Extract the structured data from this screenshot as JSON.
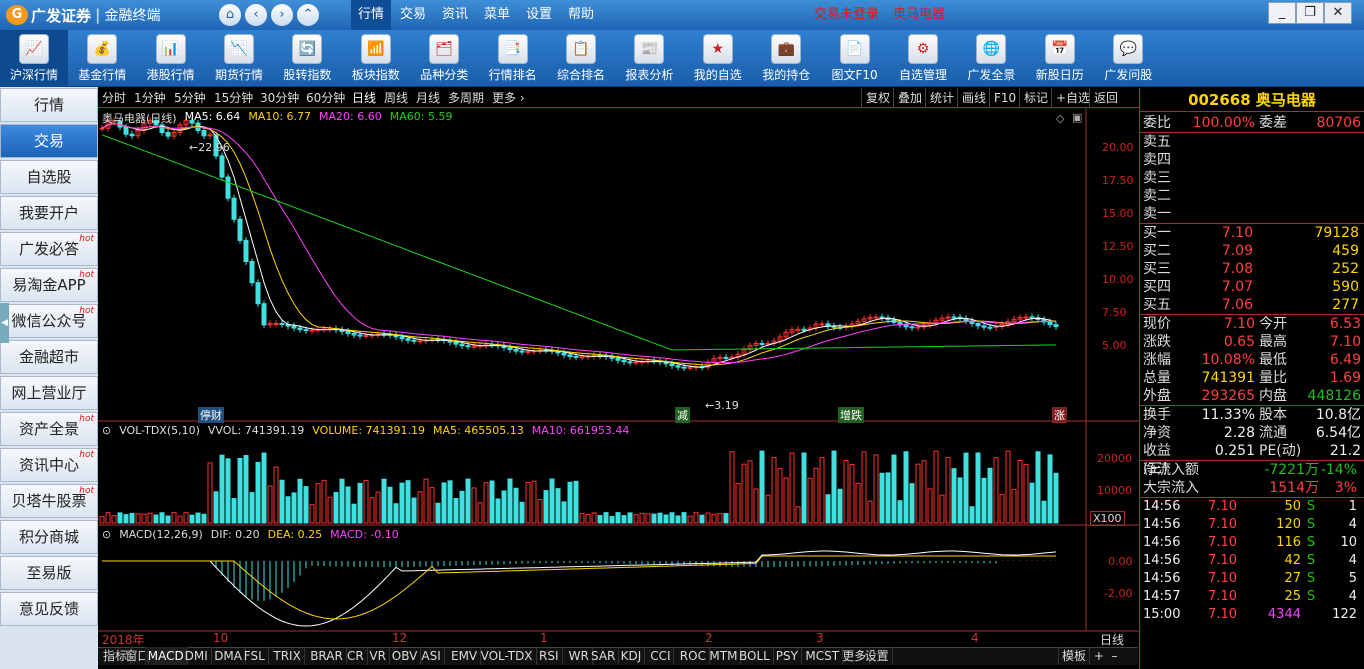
{
  "app": {
    "logo": "广发证券",
    "subtitle": "金融终端",
    "menus": [
      "行情",
      "交易",
      "资讯",
      "菜单",
      "设置",
      "帮助"
    ],
    "status_login": "交易未登录",
    "status_stock": "奥马电器",
    "window_buttons": [
      "minimize-icon",
      "restore-icon",
      "close-icon"
    ]
  },
  "toolbar": [
    "沪深行情",
    "基金行情",
    "港股行情",
    "期货行情",
    "股转指数",
    "板块指数",
    "品种分类",
    "行情排名",
    "综合排名",
    "报表分析",
    "我的自选",
    "我的持仓",
    "图文F10",
    "自选管理",
    "广发全景",
    "新股日历",
    "广发问股"
  ],
  "sidebar": [
    {
      "label": "行情",
      "hot": ""
    },
    {
      "label": "交易",
      "hot": ""
    },
    {
      "label": "自选股",
      "hot": ""
    },
    {
      "label": "我要开户",
      "hot": ""
    },
    {
      "label": "广发必答",
      "hot": "hot"
    },
    {
      "label": "易淘金APP",
      "hot": "hot"
    },
    {
      "label": "微信公众号",
      "hot": "hot"
    },
    {
      "label": "金融超市",
      "hot": ""
    },
    {
      "label": "网上营业厅",
      "hot": ""
    },
    {
      "label": "资产全景",
      "hot": "hot"
    },
    {
      "label": "资讯中心",
      "hot": "hot"
    },
    {
      "label": "贝塔牛股票",
      "hot": "hot"
    },
    {
      "label": "积分商城",
      "hot": ""
    },
    {
      "label": "至易版",
      "hot": ""
    },
    {
      "label": "意见反馈",
      "hot": ""
    }
  ],
  "periods": [
    "分时",
    "1分钟",
    "5分钟",
    "15分钟",
    "30分钟",
    "60分钟",
    "日线",
    "周线",
    "月线",
    "多周期",
    "更多 ›"
  ],
  "right_tools": [
    "复权",
    "叠加",
    "统计",
    "画线",
    "F10",
    "标记",
    "+自选",
    "返回"
  ],
  "kline": {
    "title": "奥马电器(日线)",
    "ma": [
      {
        "label": "MA5: 6.64",
        "color": "#ffffff"
      },
      {
        "label": "MA10: 6.77",
        "color": "#ffd400"
      },
      {
        "label": "MA20: 6.60",
        "color": "#ff40ff"
      },
      {
        "label": "MA60: 5.59",
        "color": "#20d020"
      }
    ],
    "y_ticks": [
      "20.00",
      "17.50",
      "15.00",
      "12.50",
      "10.00",
      "7.50",
      "5.00"
    ],
    "high_label": "22.96",
    "low_label": "3.19",
    "markers": [
      "停财",
      "减",
      "增跌",
      "涨"
    ]
  },
  "volume": {
    "title": "VOL-TDX(5,10)",
    "vol": "VVOL: 741391.19",
    "volume": "VOLUME: 741391.19",
    "ma5": "MA5: 465505.13",
    "ma10": "MA10: 661953.44",
    "y_ticks": [
      "20000",
      "10000"
    ],
    "unit": "X100"
  },
  "macd": {
    "title": "MACD(12,26,9)",
    "dif": "DIF: 0.20",
    "dea": "DEA: 0.25",
    "macd": "MACD: -0.10",
    "y_ticks": [
      "0.00",
      "-2.00"
    ]
  },
  "x_labels": [
    "2018年",
    "10",
    "12",
    "1",
    "2",
    "3",
    "4"
  ],
  "x_unit": "日线",
  "indicators": [
    "指标",
    "窗口",
    "MACD",
    "DMI",
    "DMA",
    "FSL",
    "TRIX",
    "BRAR",
    "CR",
    "VR",
    "OBV",
    "ASI",
    "EMV",
    "VOL-TDX",
    "RSI",
    "WR",
    "SAR",
    "KDJ",
    "CCI",
    "ROC",
    "MTM",
    "BOLL",
    "PSY",
    "MCST",
    "更多",
    "设置",
    "模板"
  ],
  "quote": {
    "code": "002668",
    "name": "奥马电器",
    "weibi_label": "委比",
    "weibi": "100.00%",
    "weicha_label": "委差",
    "weicha": "80706",
    "sells": [
      "卖五",
      "卖四",
      "卖三",
      "卖二",
      "卖一"
    ],
    "buys": [
      {
        "label": "买一",
        "price": "7.10",
        "vol": "79128"
      },
      {
        "label": "买二",
        "price": "7.09",
        "vol": "459"
      },
      {
        "label": "买三",
        "price": "7.08",
        "vol": "252"
      },
      {
        "label": "买四",
        "price": "7.07",
        "vol": "590"
      },
      {
        "label": "买五",
        "price": "7.06",
        "vol": "277"
      }
    ],
    "stats": [
      {
        "l1": "现价",
        "v1": "7.10",
        "c1": "red",
        "l2": "今开",
        "v2": "6.53",
        "c2": "red"
      },
      {
        "l1": "涨跌",
        "v1": "0.65",
        "c1": "red",
        "l2": "最高",
        "v2": "7.10",
        "c2": "red"
      },
      {
        "l1": "涨幅",
        "v1": "10.08%",
        "c1": "red",
        "l2": "最低",
        "v2": "6.49",
        "c2": "red"
      },
      {
        "l1": "总量",
        "v1": "741391",
        "c1": "yel",
        "l2": "量比",
        "v2": "1.69",
        "c2": "red"
      },
      {
        "l1": "外盘",
        "v1": "293265",
        "c1": "red",
        "l2": "内盘",
        "v2": "448126",
        "c2": "grn"
      }
    ],
    "stats2": [
      {
        "l1": "换手",
        "v1": "11.33%",
        "l2": "股本",
        "v2": "10.8亿"
      },
      {
        "l1": "净资",
        "v1": "2.28",
        "l2": "流通",
        "v2": "6.54亿"
      },
      {
        "l1": "收益(三)",
        "v1": "0.251",
        "l2": "PE(动)",
        "v2": "21.2"
      }
    ],
    "flow": [
      {
        "label": "净流入额",
        "value": "-7221万",
        "pct": "-14%",
        "color": "grn"
      },
      {
        "label": "大宗流入",
        "value": "1514万",
        "pct": "3%",
        "color": "red"
      }
    ],
    "ticks": [
      {
        "time": "14:56",
        "price": "7.10",
        "vol": "50",
        "side": "S",
        "n": "1"
      },
      {
        "time": "14:56",
        "price": "7.10",
        "vol": "120",
        "side": "S",
        "n": "4"
      },
      {
        "time": "14:56",
        "price": "7.10",
        "vol": "116",
        "side": "S",
        "n": "10"
      },
      {
        "time": "14:56",
        "price": "7.10",
        "vol": "42",
        "side": "S",
        "n": "4"
      },
      {
        "time": "14:56",
        "price": "7.10",
        "vol": "27",
        "side": "S",
        "n": "5"
      },
      {
        "time": "14:57",
        "price": "7.10",
        "vol": "25",
        "side": "S",
        "n": "4"
      },
      {
        "time": "15:00",
        "price": "7.10",
        "vol": "4344",
        "side": "",
        "n": "122"
      }
    ]
  }
}
